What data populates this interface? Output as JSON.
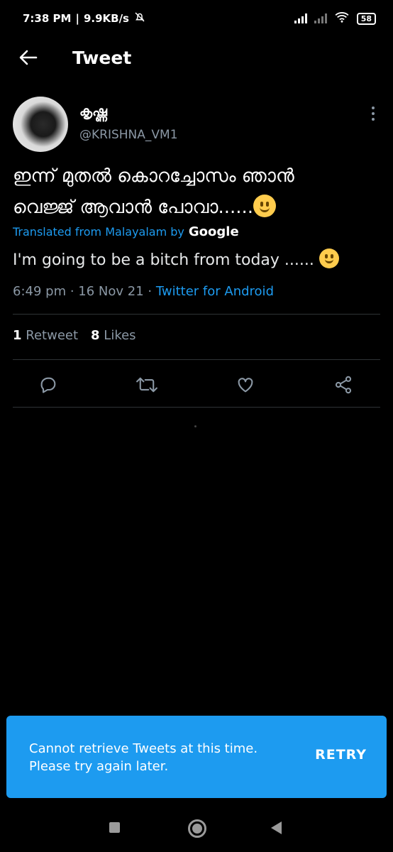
{
  "status_bar": {
    "time": "7:38 PM",
    "speed": "9.9KB/s",
    "battery": "58"
  },
  "header": {
    "title": "Tweet"
  },
  "tweet": {
    "display_name": "കൃഷ്ണ",
    "handle": "@KRISHNA_VM1",
    "text_line1": "ഇന്ന് മുതൽ കൊറച്ചോസം ഞാൻ",
    "text_line2": "വെജ്ജ് ആവാൻ പോവാ......",
    "translated_label": "Translated from Malayalam by",
    "translated_provider": "Google",
    "translation": "I'm going to be a bitch from today ......",
    "time": "6:49 pm",
    "date": "16 Nov 21",
    "source": "Twitter for Android",
    "retweet_count": "1",
    "retweet_label": "Retweet",
    "like_count": "8",
    "like_label": "Likes"
  },
  "snackbar": {
    "line1": "Cannot retrieve Tweets at this time.",
    "line2": "Please try again later.",
    "action": "RETRY"
  },
  "colors": {
    "accent": "#1d9bf0",
    "background": "#000000",
    "muted": "#8b98a5"
  }
}
